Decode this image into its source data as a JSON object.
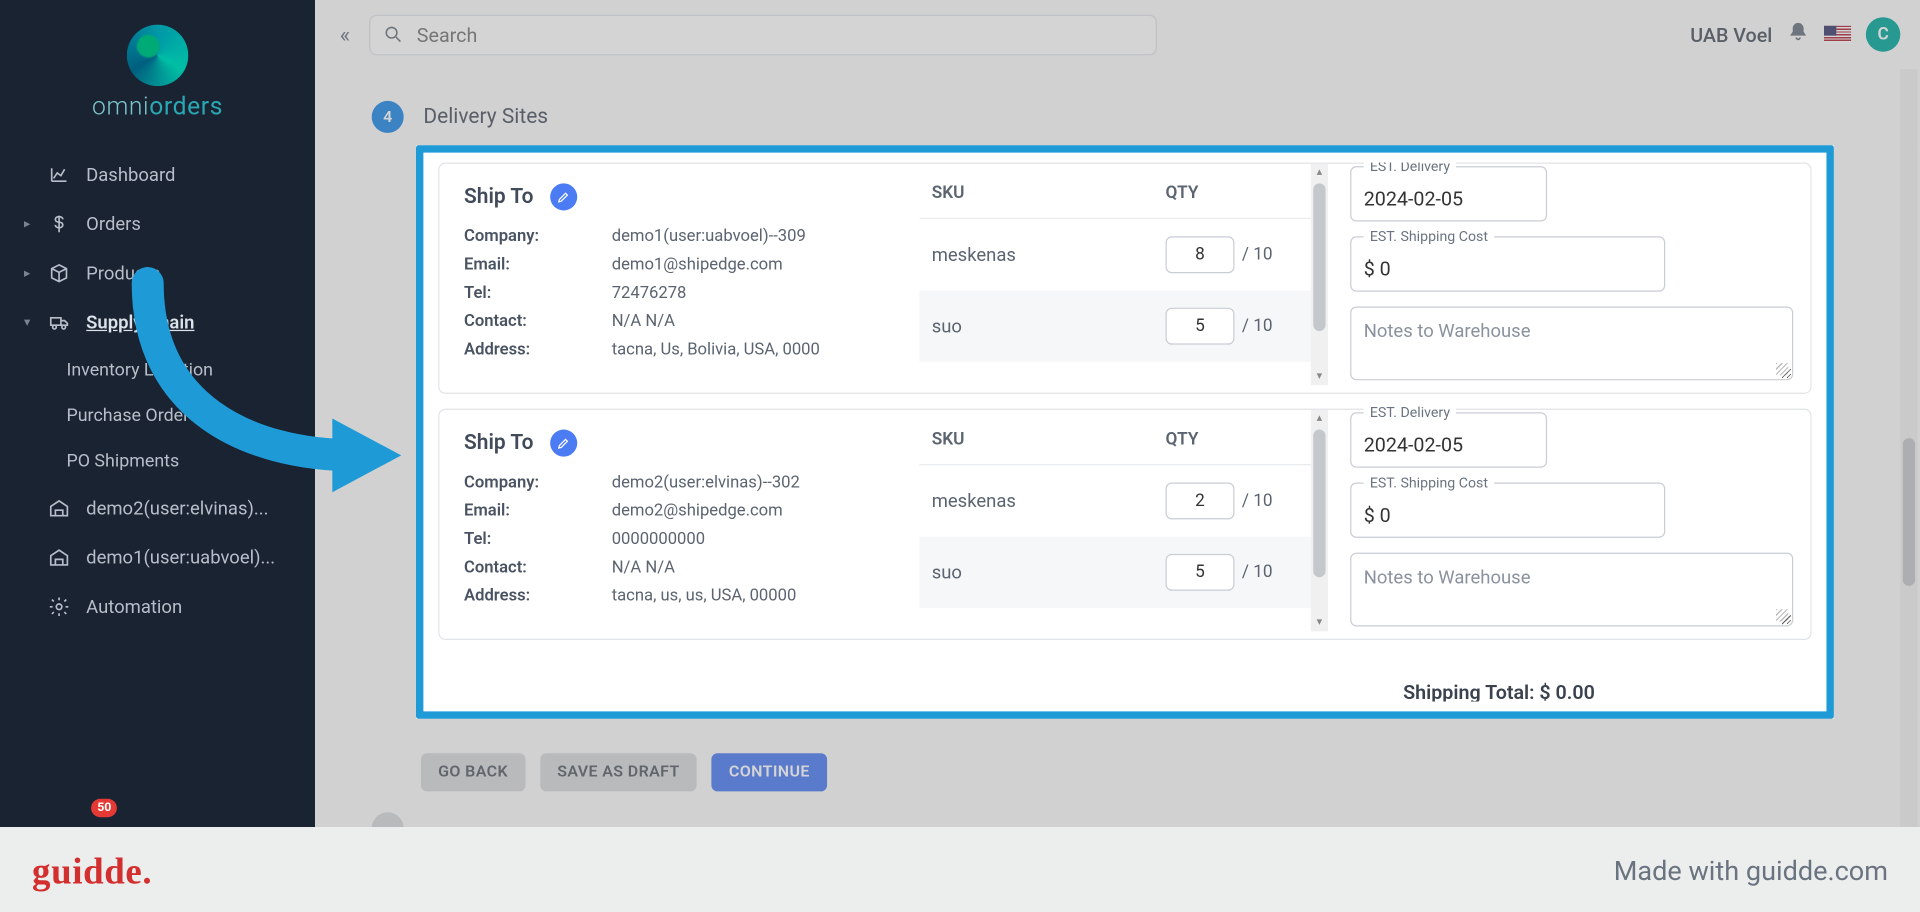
{
  "app": {
    "logo_brand_a": "omni",
    "logo_brand_b": "orders"
  },
  "topbar": {
    "search_placeholder": "Search",
    "company": "UAB Voel",
    "avatar_initial": "C"
  },
  "sidebar": {
    "items": [
      {
        "icon": "chart",
        "label": "Dashboard",
        "chev": ""
      },
      {
        "icon": "dollar",
        "label": "Orders",
        "chev": "▸"
      },
      {
        "icon": "cube",
        "label": "Products",
        "chev": "▸"
      },
      {
        "icon": "truck",
        "label": "Supply Chain",
        "chev": "▾",
        "active": true
      },
      {
        "icon": "",
        "label": "Inventory Location",
        "sub": true
      },
      {
        "icon": "",
        "label": "Purchase Orders",
        "sub": true
      },
      {
        "icon": "",
        "label": "PO Shipments",
        "sub": true
      },
      {
        "icon": "warehouse",
        "label": "demo2(user:elvinas)..."
      },
      {
        "icon": "warehouse",
        "label": "demo1(user:uabvoel)..."
      },
      {
        "icon": "gear",
        "label": "Automation",
        "badge": "50"
      }
    ]
  },
  "step": {
    "number": "4",
    "title": "Delivery Sites"
  },
  "sku_headers": {
    "sku": "SKU",
    "qty": "QTY"
  },
  "right_labels": {
    "est_delivery": "EST. Delivery",
    "est_ship_cost": "EST. Shipping Cost",
    "notes_placeholder": "Notes to Warehouse"
  },
  "sites": [
    {
      "title": "Ship To",
      "company": "demo1(user:uabvoel)--309",
      "email": "demo1@shipedge.com",
      "tel": "72476278",
      "contact": "N/A N/A",
      "address": "tacna, Us, Bolivia, USA, 0000",
      "rows": [
        {
          "sku": "meskenas",
          "qty": "8",
          "max": "/ 10"
        },
        {
          "sku": "suo",
          "qty": "5",
          "max": "/ 10"
        }
      ],
      "est_delivery": "2024-02-05",
      "est_cost": "$ 0",
      "notes": ""
    },
    {
      "title": "Ship To",
      "company": "demo2(user:elvinas)--302",
      "email": "demo2@shipedge.com",
      "tel": "0000000000",
      "contact": "N/A N/A",
      "address": "tacna, us, us, USA, 00000",
      "rows": [
        {
          "sku": "meskenas",
          "qty": "2",
          "max": "/ 10"
        },
        {
          "sku": "suo",
          "qty": "5",
          "max": "/ 10"
        }
      ],
      "est_delivery": "2024-02-05",
      "est_cost": "$ 0",
      "notes": ""
    }
  ],
  "labels": {
    "company": "Company:",
    "email": "Email:",
    "tel": "Tel:",
    "contact": "Contact:",
    "address": "Address:"
  },
  "shipping_total": "Shipping Total: $ 0.00",
  "actions": {
    "go_back": "GO BACK",
    "save_draft": "SAVE AS DRAFT",
    "continue": "CONTINUE"
  },
  "footer": {
    "logo": "guidde.",
    "made_with": "Made with guidde.com"
  }
}
